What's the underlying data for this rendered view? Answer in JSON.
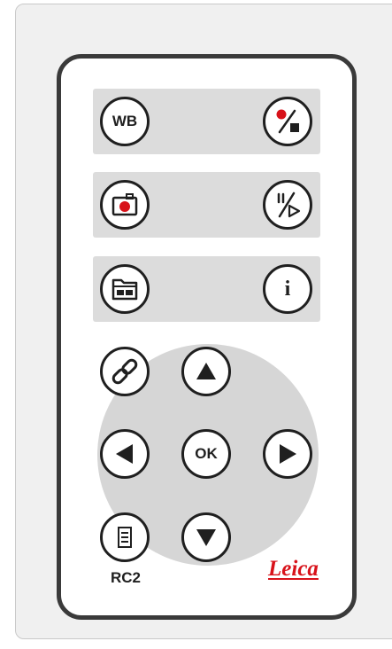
{
  "remote": {
    "model_label": "RC2",
    "brand_logo": "Leica",
    "accent_color": "#d8121a",
    "body_border_color": "#3a3a3a",
    "button_face_color": "#ffffff",
    "button_bar_color": "#dcdcdc"
  },
  "buttons": {
    "white_balance": {
      "label": "WB",
      "icon": "wb-text"
    },
    "record_stop": {
      "icon": "record-stop-icon"
    },
    "capture_image": {
      "icon": "camera-icon"
    },
    "play_pause": {
      "icon": "pause-play-icon"
    },
    "gallery": {
      "icon": "gallery-folder-icon"
    },
    "info": {
      "label": "i",
      "icon": "info-icon"
    },
    "link": {
      "icon": "link-icon"
    },
    "up": {
      "icon": "arrow-up-icon"
    },
    "left": {
      "icon": "arrow-left-icon"
    },
    "ok": {
      "label": "OK"
    },
    "right": {
      "icon": "arrow-right-icon"
    },
    "menu": {
      "icon": "menu-list-icon"
    },
    "down": {
      "icon": "arrow-down-icon"
    }
  }
}
